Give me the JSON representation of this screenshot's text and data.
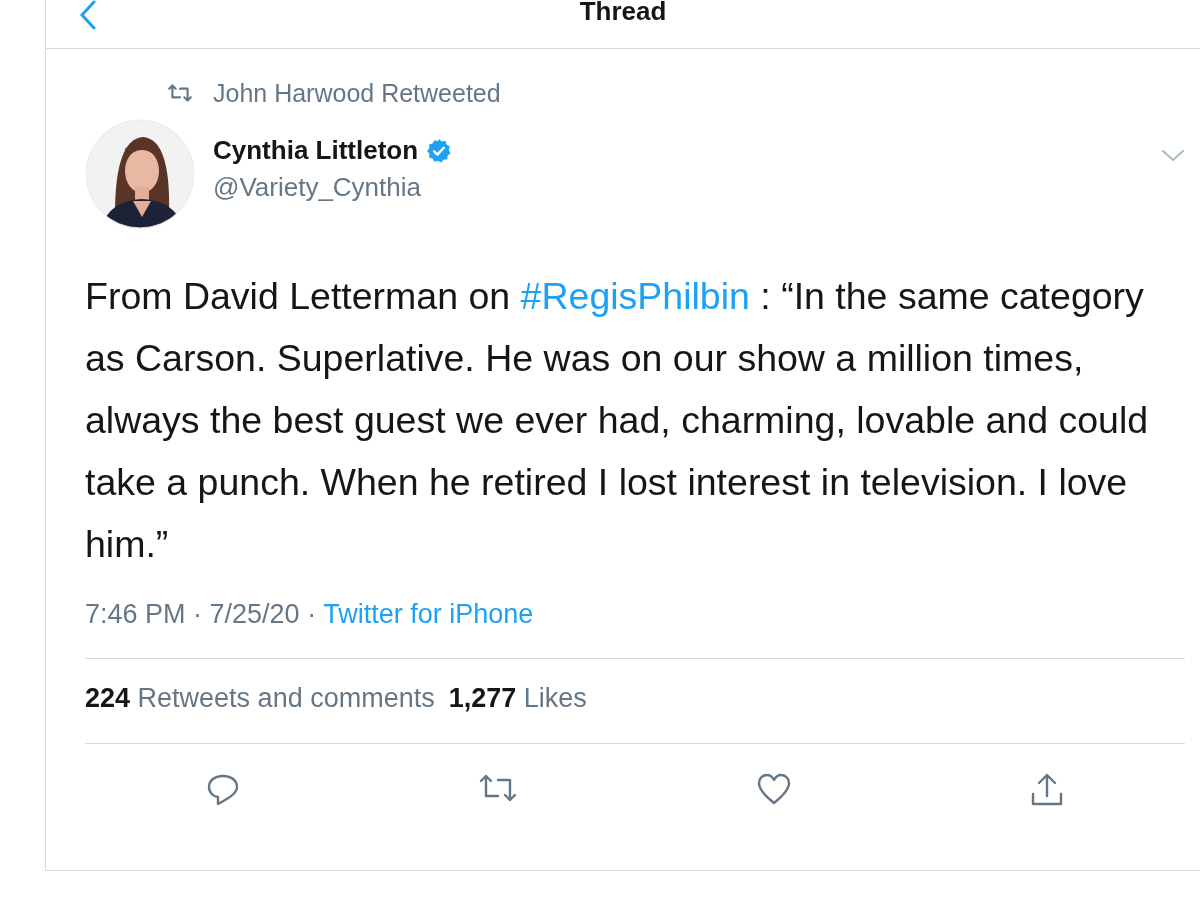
{
  "header": {
    "title": "Thread"
  },
  "retweeted_by": "John Harwood Retweeted",
  "author": {
    "name": "Cynthia Littleton",
    "verified": true,
    "handle": "@Variety_Cynthia"
  },
  "tweet": {
    "text_before": "From David Letterman on ",
    "hashtag": "#RegisPhilbin",
    "text_after": " : “In the same category as Carson. Superlative. He was on our show a million times, always the best guest we ever had, charming, lovable and could take a punch. When he retired I lost interest in television. I love him.”"
  },
  "meta": {
    "time": "7:46 PM · 7/25/20 · ",
    "source": "Twitter for iPhone"
  },
  "stats": [
    {
      "count": "224",
      "label": "Retweets and comments"
    },
    {
      "count": "1,277",
      "label": "Likes"
    }
  ],
  "actions": [
    {
      "kind": "reply"
    },
    {
      "kind": "retweet"
    },
    {
      "kind": "like"
    },
    {
      "kind": "share"
    }
  ]
}
